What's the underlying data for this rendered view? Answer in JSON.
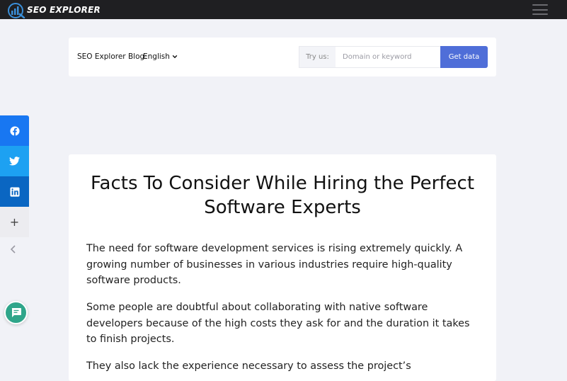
{
  "nav": {
    "logo_text": "SEO EXPLORER"
  },
  "blogbar": {
    "label": "SEO Explorer Blog:",
    "language": "English",
    "try_label": "Try us:",
    "input_placeholder": "Domain or keyword",
    "button_label": "Get data"
  },
  "social": {
    "plus_label": "+",
    "icons": [
      "facebook-icon",
      "twitter-icon",
      "linkedin-icon",
      "plus-icon",
      "chevron-left-icon"
    ]
  },
  "article": {
    "title": "Facts To Consider While Hiring the Perfect Software Experts",
    "paragraphs": [
      "The need for software development services is rising extremely quickly. A growing number of businesses in various industries require high-quality software products.",
      "Some people are doubtful about collaborating with native software developers because of the high costs they ask for and the duration it takes to finish projects.",
      "They also lack the experience necessary to assess the project’s"
    ]
  },
  "colors": {
    "topnav": "#1f1f22",
    "accent_button": "#4f6ed8",
    "facebook": "#1877f2",
    "twitter": "#1da1f2",
    "linkedin": "#0a66c2",
    "chat": "#2fa58a",
    "page_background": "#f1f2f7"
  }
}
